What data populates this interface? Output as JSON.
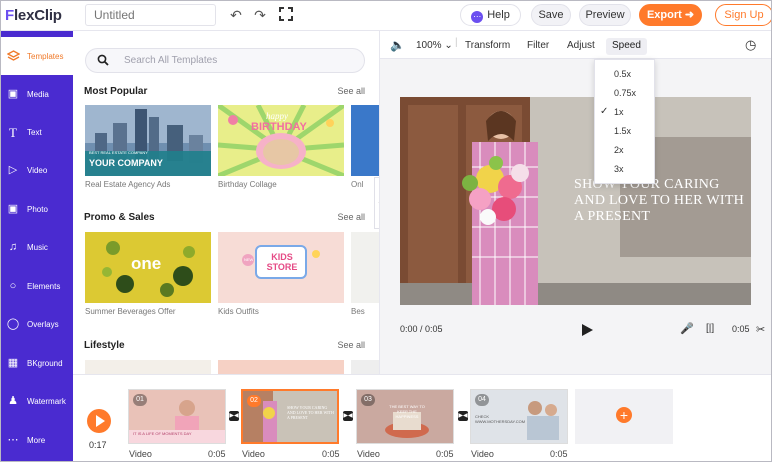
{
  "app": {
    "logo": "lexClip",
    "logo_f": "F",
    "title_placeholder": "Untitled"
  },
  "topbar": {
    "help": "Help",
    "save": "Save",
    "preview": "Preview",
    "export": "Export",
    "signup": "Sign Up"
  },
  "sidebar": {
    "items": [
      {
        "label": "Templates",
        "icon": "layers-icon"
      },
      {
        "label": "Media",
        "icon": "folder-icon"
      },
      {
        "label": "Text",
        "icon": "text-icon"
      },
      {
        "label": "Video",
        "icon": "video-icon"
      },
      {
        "label": "Photo",
        "icon": "photo-icon"
      },
      {
        "label": "Music",
        "icon": "music-icon"
      },
      {
        "label": "Elements",
        "icon": "elements-icon"
      },
      {
        "label": "Overlays",
        "icon": "overlays-icon"
      },
      {
        "label": "BKground",
        "icon": "background-icon"
      },
      {
        "label": "Watermark",
        "icon": "watermark-icon"
      },
      {
        "label": "More",
        "icon": "more-icon"
      }
    ]
  },
  "templates": {
    "search_placeholder": "Search All Templates",
    "see_all": "See all",
    "sections": [
      {
        "title": "Most Popular",
        "items": [
          {
            "label": "Real Estate Agency Ads",
            "caption": "YOUR COMPANY",
            "subcaption": "BEST REAL ESTATE COMPANY"
          },
          {
            "label": "Birthday Collage",
            "caption": "BIRTHDAY",
            "subcaption": "happy"
          },
          {
            "label": "Onl"
          }
        ]
      },
      {
        "title": "Promo & Sales",
        "items": [
          {
            "label": "Summer Beverages Offer",
            "caption": "one"
          },
          {
            "label": "Kids Outfits",
            "caption": "KIDS STORE",
            "subcaption": "NEW"
          },
          {
            "label": "Bes"
          }
        ]
      },
      {
        "title": "Lifestyle",
        "items": []
      }
    ]
  },
  "editor": {
    "zoom": "100%",
    "tools": [
      "Transform",
      "Filter",
      "Adjust",
      "Speed"
    ],
    "overlay_text": "SHOW YOUR CARING AND LOVE TO HER WITH A PRESENT",
    "time_current": "0:00 / 0:05",
    "time_total": "0:05"
  },
  "speed_menu": {
    "options": [
      "0.5x",
      "0.75x",
      "1x",
      "1.5x",
      "2x",
      "3x"
    ],
    "selected": "1x"
  },
  "timeline": {
    "time": "0:17",
    "clips": [
      {
        "num": "01",
        "name": "Video",
        "dur": "0:05",
        "caption": "IT IS A LIFE OF MOMENTS DAY"
      },
      {
        "num": "02",
        "name": "Video",
        "dur": "0:05",
        "caption": "SHOW YOUR CARING AND LOVE TO HER WITH A PRESENT"
      },
      {
        "num": "03",
        "name": "Video",
        "dur": "0:05",
        "caption": "THE BEST WAY TO KEEP THE HAPPINESS"
      },
      {
        "num": "04",
        "name": "Video",
        "dur": "0:05",
        "caption": "CHECK WWW.MOTHERSDAY.COM"
      }
    ]
  },
  "colors": {
    "brand": "#4a2bd0",
    "accent": "#ff7a2b"
  }
}
